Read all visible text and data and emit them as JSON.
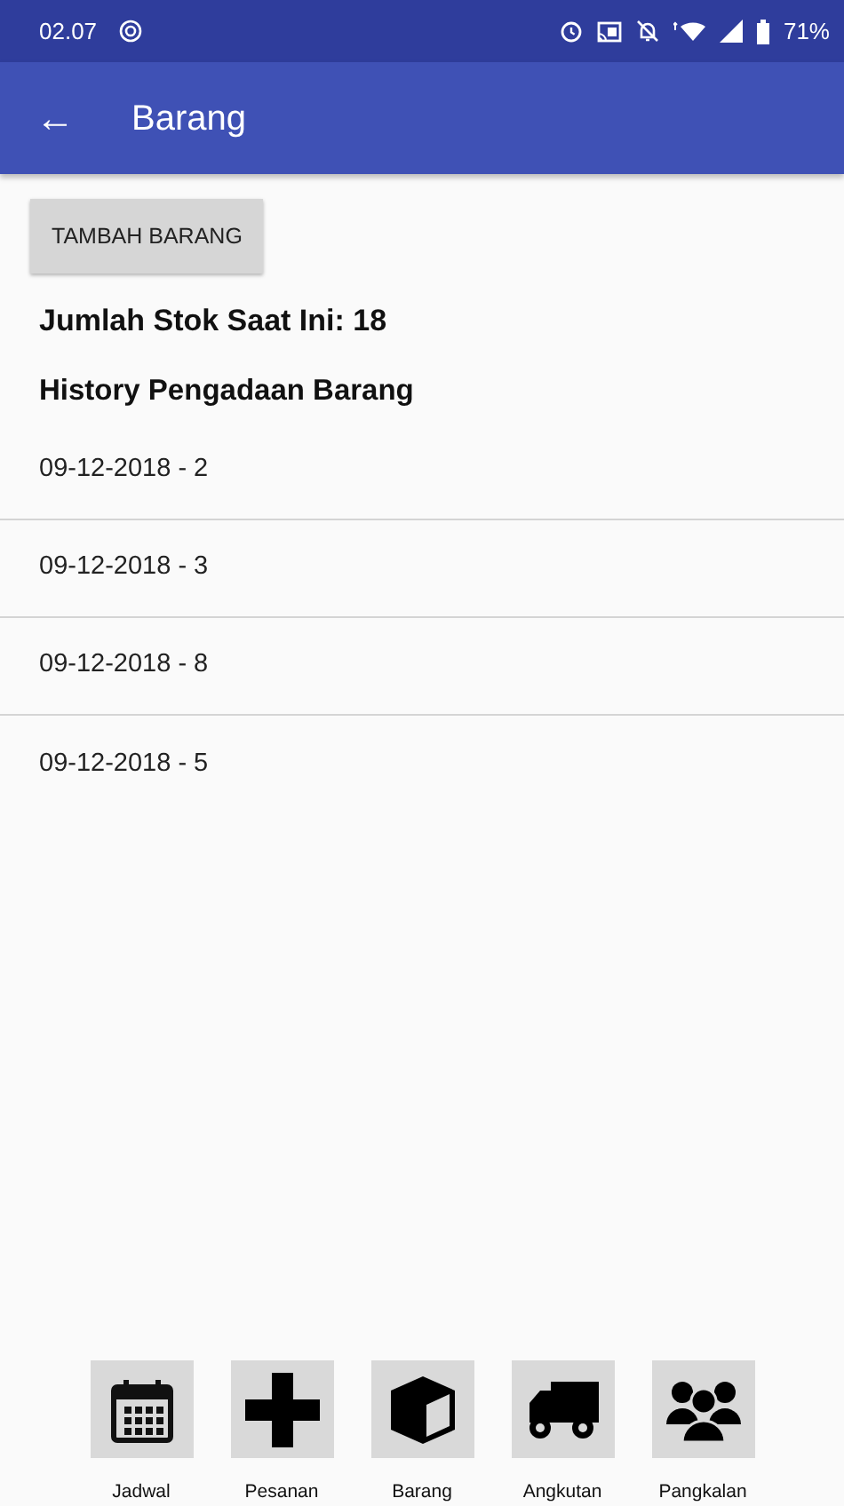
{
  "status_bar": {
    "time": "02.07",
    "battery": "71%"
  },
  "app_bar": {
    "back": "←",
    "title": "Barang"
  },
  "add_button": "TAMBAH BARANG",
  "stock": "Jumlah Stok Saat Ini: 18",
  "history_title": "History Pengadaan Barang",
  "history": [
    "09-12-2018 - 2",
    "09-12-2018 - 3",
    "09-12-2018 - 8",
    "09-12-2018 - 5"
  ],
  "bottom_nav": [
    {
      "kind": "calendar",
      "label": "Jadwal"
    },
    {
      "kind": "plus",
      "label": "Pesanan"
    },
    {
      "kind": "box",
      "label": "Barang"
    },
    {
      "kind": "truck",
      "label": "Angkutan"
    },
    {
      "kind": "people",
      "label": "Pangkalan"
    }
  ]
}
